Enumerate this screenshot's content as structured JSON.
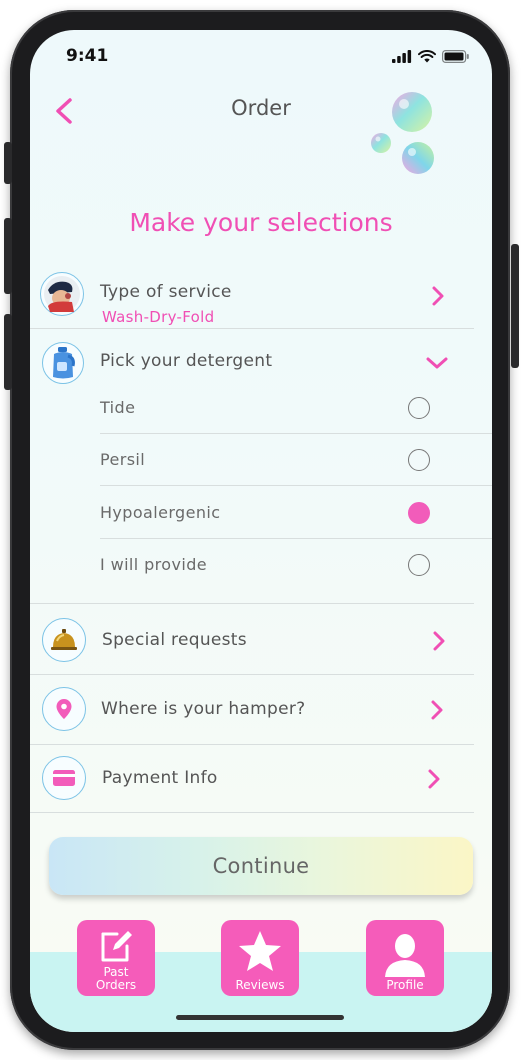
{
  "status": {
    "time": "9:41"
  },
  "header": {
    "title": "Order"
  },
  "heading": "Make your selections",
  "service": {
    "label": "Type of service",
    "value": "Wash-Dry-Fold"
  },
  "detergent": {
    "label": "Pick your detergent",
    "options": [
      {
        "label": "Tide",
        "selected": false
      },
      {
        "label": "Persil",
        "selected": false
      },
      {
        "label": "Hypoalergenic",
        "selected": true
      },
      {
        "label": "I will provide",
        "selected": false
      }
    ]
  },
  "special": {
    "label": "Special requests"
  },
  "hamper": {
    "label": "Where is your hamper?"
  },
  "payment": {
    "label": "Payment Info"
  },
  "continue_label": "Continue",
  "tabs": [
    {
      "label": "Past Orders",
      "icon": "edit-icon"
    },
    {
      "label": "Reviews",
      "icon": "star-icon"
    },
    {
      "label": "Profile",
      "icon": "user-icon"
    }
  ],
  "colors": {
    "accent": "#f04fb4",
    "tab": "#f55cba",
    "icon_border": "#7cc3e6"
  }
}
